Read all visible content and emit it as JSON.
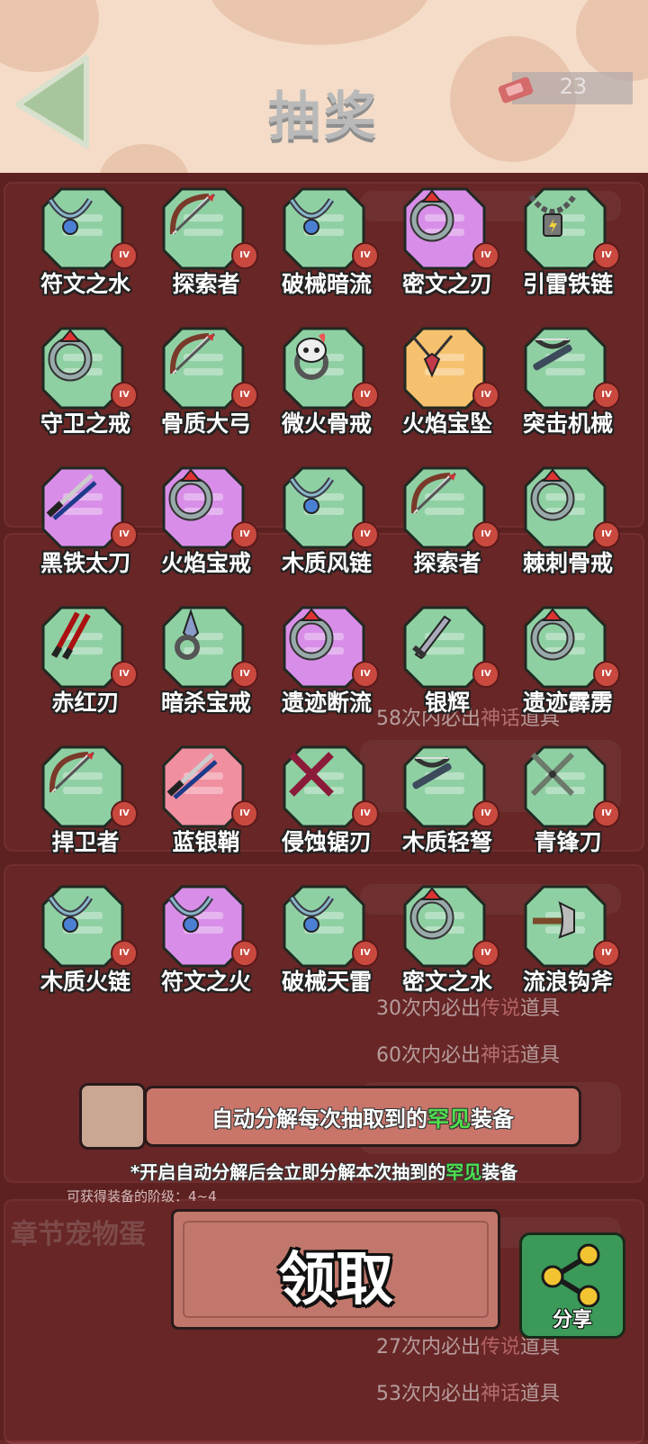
{
  "header": {
    "title": "抽奖",
    "ticket_count": "23"
  },
  "colors": {
    "common_frame": "#8fd0a3",
    "epic_frame": "#d88ee8",
    "legend_frame": "#f6c16e",
    "rare_frame": "#f08fa0",
    "tier_badge": "#c9493f"
  },
  "items": [
    {
      "name": "符文之水",
      "tier": "IV",
      "rarity": "common",
      "icon": "necklace-icon"
    },
    {
      "name": "探索者",
      "tier": "IV",
      "rarity": "common",
      "icon": "bow-icon"
    },
    {
      "name": "破械暗流",
      "tier": "IV",
      "rarity": "common",
      "icon": "necklace-icon"
    },
    {
      "name": "密文之刃",
      "tier": "IV",
      "rarity": "epic",
      "icon": "ring-icon"
    },
    {
      "name": "引雷铁链",
      "tier": "IV",
      "rarity": "common",
      "icon": "chain-icon"
    },
    {
      "name": "守卫之戒",
      "tier": "IV",
      "rarity": "common",
      "icon": "ring-icon"
    },
    {
      "name": "骨质大弓",
      "tier": "IV",
      "rarity": "common",
      "icon": "bow-icon"
    },
    {
      "name": "微火骨戒",
      "tier": "IV",
      "rarity": "common",
      "icon": "skull-ring-icon"
    },
    {
      "name": "火焰宝坠",
      "tier": "IV",
      "rarity": "legend",
      "icon": "pendant-icon"
    },
    {
      "name": "突击机械",
      "tier": "IV",
      "rarity": "common",
      "icon": "crossbow-icon"
    },
    {
      "name": "黑铁太刀",
      "tier": "IV",
      "rarity": "epic",
      "icon": "katana-icon"
    },
    {
      "name": "火焰宝戒",
      "tier": "IV",
      "rarity": "epic",
      "icon": "ring-icon"
    },
    {
      "name": "木质风链",
      "tier": "IV",
      "rarity": "common",
      "icon": "necklace-icon"
    },
    {
      "name": "探索者",
      "tier": "IV",
      "rarity": "common",
      "icon": "bow-icon"
    },
    {
      "name": "棘刺骨戒",
      "tier": "IV",
      "rarity": "common",
      "icon": "ring-icon"
    },
    {
      "name": "赤红刃",
      "tier": "IV",
      "rarity": "common",
      "icon": "blades-icon"
    },
    {
      "name": "暗杀宝戒",
      "tier": "IV",
      "rarity": "common",
      "icon": "dagger-ring-icon"
    },
    {
      "name": "遗迹断流",
      "tier": "IV",
      "rarity": "epic",
      "icon": "ring-icon"
    },
    {
      "name": "银辉",
      "tier": "IV",
      "rarity": "common",
      "icon": "sword-icon"
    },
    {
      "name": "遗迹霹雳",
      "tier": "IV",
      "rarity": "common",
      "icon": "ring-icon"
    },
    {
      "name": "捍卫者",
      "tier": "IV",
      "rarity": "common",
      "icon": "bow-icon"
    },
    {
      "name": "蓝银鞘",
      "tier": "IV",
      "rarity": "rare",
      "icon": "katana-icon"
    },
    {
      "name": "侵蚀锯刃",
      "tier": "IV",
      "rarity": "common",
      "icon": "saw-blades-icon"
    },
    {
      "name": "木质轻弩",
      "tier": "IV",
      "rarity": "common",
      "icon": "crossbow-icon"
    },
    {
      "name": "青锋刀",
      "tier": "IV",
      "rarity": "common",
      "icon": "crossed-swords-icon"
    },
    {
      "name": "木质火链",
      "tier": "IV",
      "rarity": "common",
      "icon": "necklace-icon"
    },
    {
      "name": "符文之火",
      "tier": "IV",
      "rarity": "epic",
      "icon": "necklace-icon"
    },
    {
      "name": "破械天雷",
      "tier": "IV",
      "rarity": "common",
      "icon": "necklace-icon"
    },
    {
      "name": "密文之水",
      "tier": "IV",
      "rarity": "common",
      "icon": "ring-icon"
    },
    {
      "name": "流浪钩斧",
      "tier": "IV",
      "rarity": "common",
      "icon": "axe-icon"
    }
  ],
  "background": {
    "label_chapter": "章节宠物蛋",
    "guarantee_30_prefix": "30次内必出",
    "guarantee_30_legend": "传说",
    "guarantee_30_suffix": "道具",
    "guarantee_60_prefix": "60次内必出",
    "guarantee_60_myth": "神话",
    "guarantee_60_suffix": "道具",
    "guarantee_58_prefix": "58次内必出",
    "guarantee_58_myth": "神话",
    "guarantee_58_suffix": "道具",
    "guarantee_27_prefix": "27次内必出",
    "guarantee_27_legend": "传说",
    "guarantee_27_suffix": "道具",
    "guarantee_53_prefix": "53次内必出",
    "guarantee_53_myth": "神话",
    "guarantee_53_suffix": "道具"
  },
  "auto_decompose": {
    "prefix": "自动分解每次抽取到的",
    "highlight": "罕见",
    "suffix": "装备",
    "note_prefix": "*开启自动分解后会立即分解本次抽到的",
    "note_highlight": "罕见",
    "note_suffix": "装备",
    "tier_note": "可获得装备的阶级：4~4"
  },
  "claim_label": "领取",
  "share_label": "分享"
}
